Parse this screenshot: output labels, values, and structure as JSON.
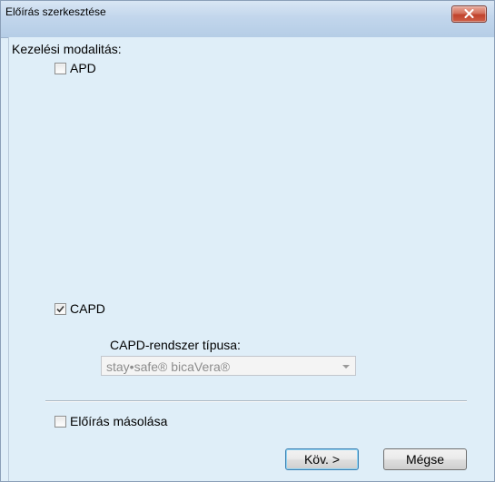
{
  "window": {
    "title": "Előírás szerkesztése",
    "close_icon": "close-icon"
  },
  "form": {
    "section_label": "Kezelési modalitás:",
    "checkboxes": [
      {
        "label": "APD",
        "checked": false
      },
      {
        "label": "CAPD",
        "checked": true
      }
    ],
    "capd_system_label": "CAPD-rendszer típusa:",
    "capd_system_select": {
      "value": "stay•safe® bicaVera®",
      "disabled": true
    },
    "copy_checkbox": {
      "label": "Előírás másolása",
      "checked": false
    }
  },
  "buttons": {
    "next_label": "Köv. >",
    "cancel_label": "Mégse"
  },
  "colors": {
    "background": "#dfeef8",
    "close_button": "#c0432c",
    "default_button_border": "#3c7fb1"
  }
}
